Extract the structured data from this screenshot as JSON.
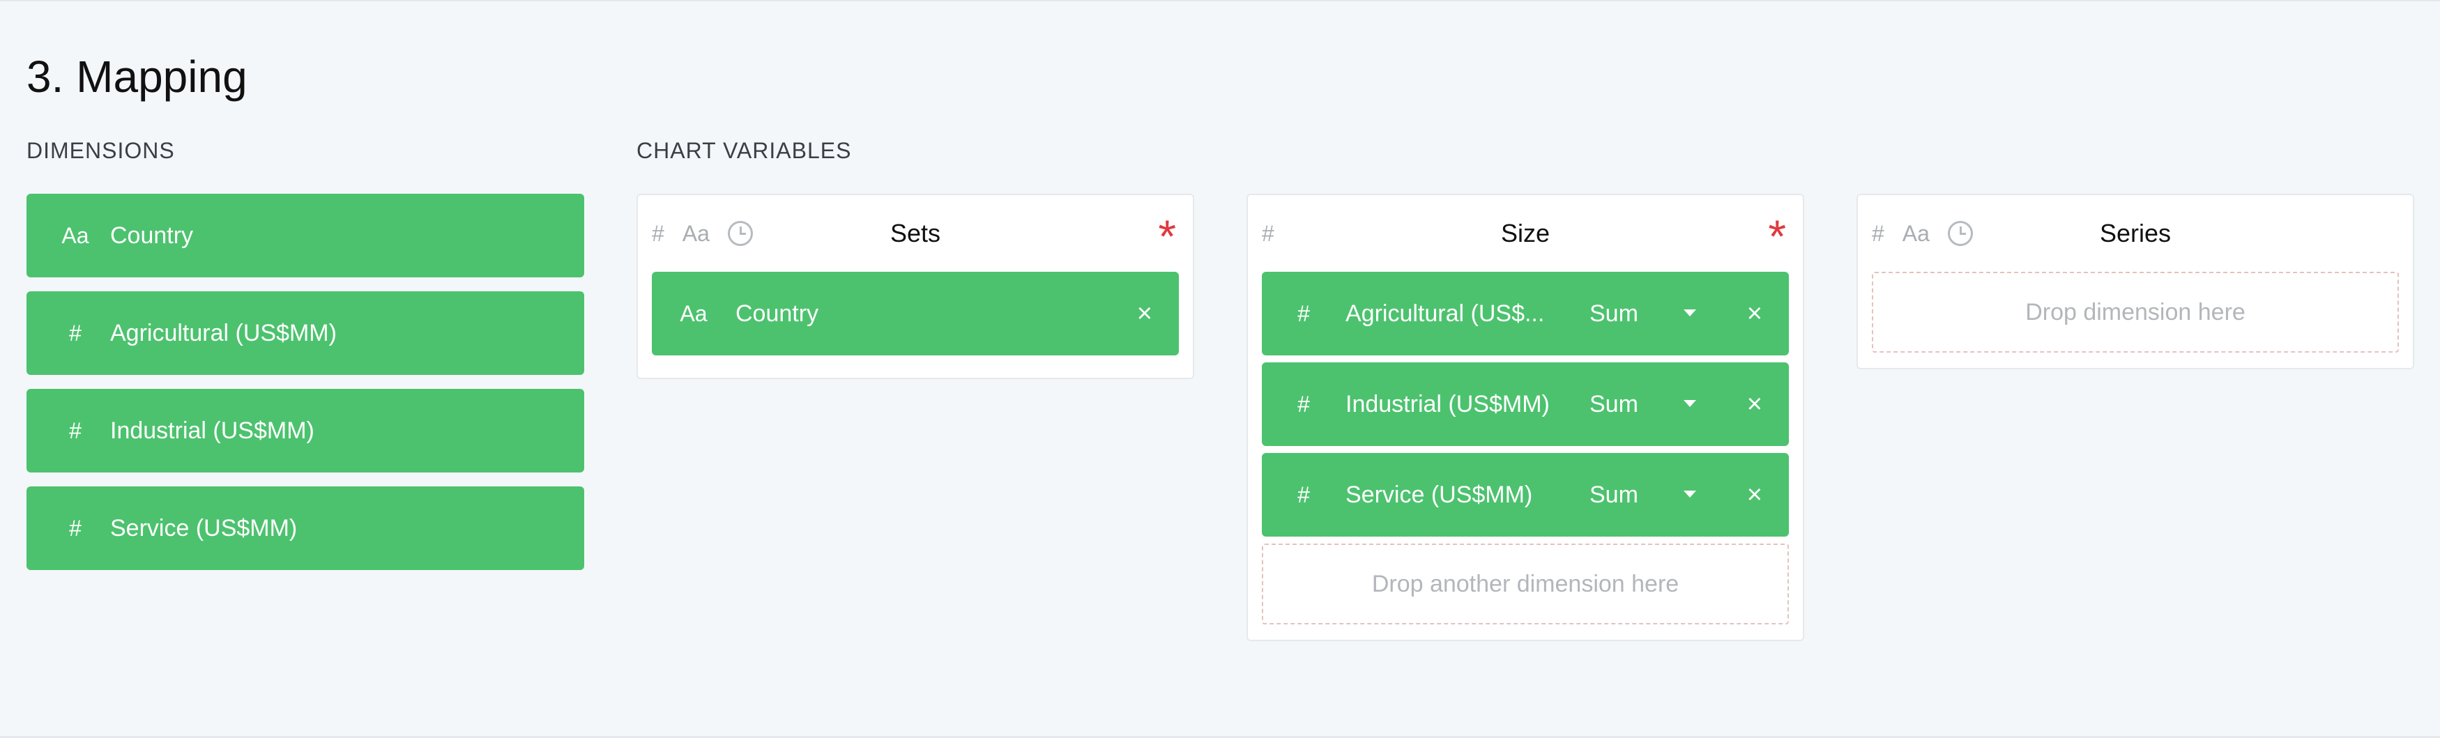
{
  "page": {
    "title": "3. Mapping"
  },
  "dimensions": {
    "label": "DIMENSIONS",
    "items": [
      {
        "type_icon": "Aa",
        "label": "Country"
      },
      {
        "type_icon": "#",
        "label": "Agricultural (US$MM)"
      },
      {
        "type_icon": "#",
        "label": "Industrial (US$MM)"
      },
      {
        "type_icon": "#",
        "label": "Service (US$MM)"
      }
    ]
  },
  "chart_variables": {
    "label": "CHART VARIABLES",
    "sets": {
      "title": "Sets",
      "required_mark": "*",
      "type_icons": [
        "#",
        "Aa",
        "clock-icon"
      ],
      "mapped": [
        {
          "type_icon": "Aa",
          "label": "Country",
          "remove": "×"
        }
      ]
    },
    "size": {
      "title": "Size",
      "required_mark": "*",
      "type_icons": [
        "#"
      ],
      "mapped": [
        {
          "type_icon": "#",
          "label": "Agricultural (US$...",
          "aggregation": "Sum",
          "remove": "×"
        },
        {
          "type_icon": "#",
          "label": "Industrial (US$MM)",
          "aggregation": "Sum",
          "remove": "×"
        },
        {
          "type_icon": "#",
          "label": "Service (US$MM)",
          "aggregation": "Sum",
          "remove": "×"
        }
      ],
      "drop_text": "Drop another dimension here"
    },
    "series": {
      "title": "Series",
      "type_icons": [
        "#",
        "Aa",
        "clock-icon"
      ],
      "drop_text": "Drop dimension here"
    }
  },
  "colors": {
    "chip": "#4cc26e",
    "required": "#e0393e",
    "background": "#f4f7fa"
  }
}
